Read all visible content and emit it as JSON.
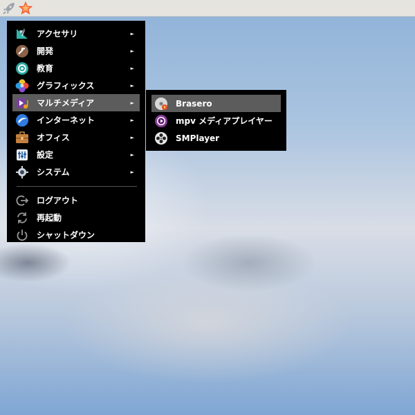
{
  "menu": {
    "categories": [
      {
        "label": "アクセサリ",
        "icon": "accessories-icon",
        "arrow": "►"
      },
      {
        "label": "開発",
        "icon": "development-icon",
        "arrow": "►"
      },
      {
        "label": "教育",
        "icon": "education-icon",
        "arrow": "►"
      },
      {
        "label": "グラフィックス",
        "icon": "graphics-icon",
        "arrow": "►"
      },
      {
        "label": "マルチメディア",
        "icon": "multimedia-icon",
        "arrow": "►",
        "active": true
      },
      {
        "label": "インターネット",
        "icon": "internet-icon",
        "arrow": "►"
      },
      {
        "label": "オフィス",
        "icon": "office-icon",
        "arrow": "►"
      },
      {
        "label": "設定",
        "icon": "settings-icon",
        "arrow": "►"
      },
      {
        "label": "システム",
        "icon": "system-icon",
        "arrow": "►"
      }
    ],
    "session": [
      {
        "label": "ログアウト",
        "icon": "logout-icon"
      },
      {
        "label": "再起動",
        "icon": "restart-icon"
      },
      {
        "label": "シャットダウン",
        "icon": "shutdown-icon"
      }
    ]
  },
  "submenu": {
    "items": [
      {
        "label": "Brasero",
        "icon": "brasero-icon",
        "active": true
      },
      {
        "label": "mpv メディアプレイヤー",
        "icon": "mpv-icon"
      },
      {
        "label": "SMPlayer",
        "icon": "smplayer-icon"
      }
    ]
  },
  "colors": {
    "menu_bg": "#000000",
    "highlight": "#5c5c5c",
    "panel": "#e6e4df"
  }
}
